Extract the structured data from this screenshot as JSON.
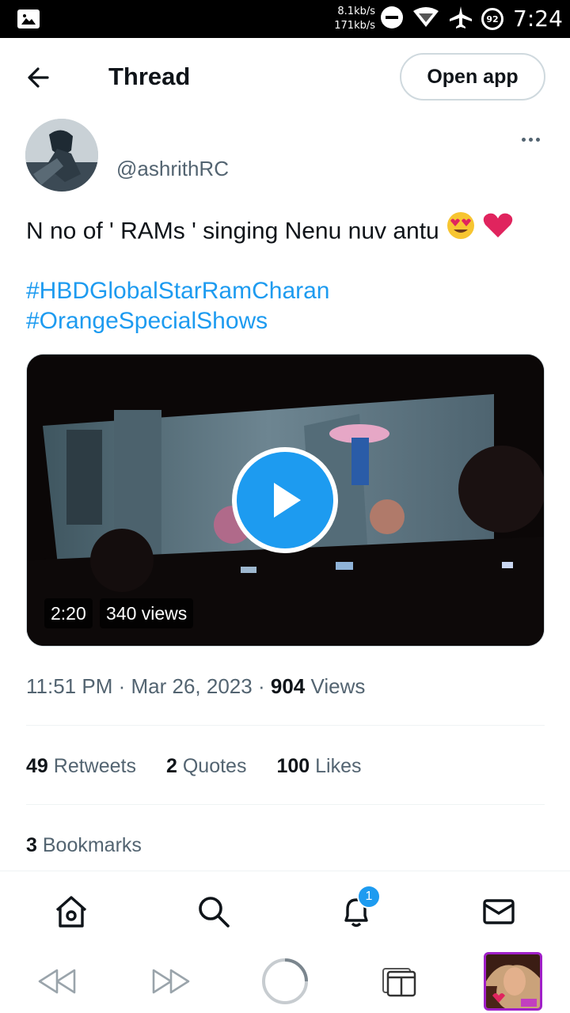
{
  "status_bar": {
    "speed_up": "8.1kb/s",
    "speed_down": "171kb/s",
    "battery": "92",
    "time": "7:24"
  },
  "header": {
    "title": "Thread",
    "open_app": "Open app"
  },
  "post": {
    "handle": "@ashrithRC",
    "text": "N no of ' RAMs ' singing Nenu nuv antu",
    "hashtags": [
      "#HBDGlobalStarRamCharan",
      "#OrangeSpecialShows"
    ],
    "video": {
      "duration": "2:20",
      "views": "340 views"
    },
    "meta": {
      "time": "11:51 PM",
      "date": "Mar 26, 2023",
      "views_count": "904",
      "views_label": "Views",
      "sep": "·"
    },
    "stats": {
      "retweets_count": "49",
      "retweets_label": "Retweets",
      "quotes_count": "2",
      "quotes_label": "Quotes",
      "likes_count": "100",
      "likes_label": "Likes",
      "bookmarks_count": "3",
      "bookmarks_label": "Bookmarks"
    }
  },
  "bottom_nav": {
    "notifications_badge": "1",
    "icons": [
      "home-icon",
      "search-icon",
      "bell-icon",
      "mail-icon"
    ]
  },
  "colors": {
    "accent": "#1d9bf0",
    "text_primary": "#0f1419",
    "text_secondary": "#536471",
    "border": "#cfd9de"
  }
}
